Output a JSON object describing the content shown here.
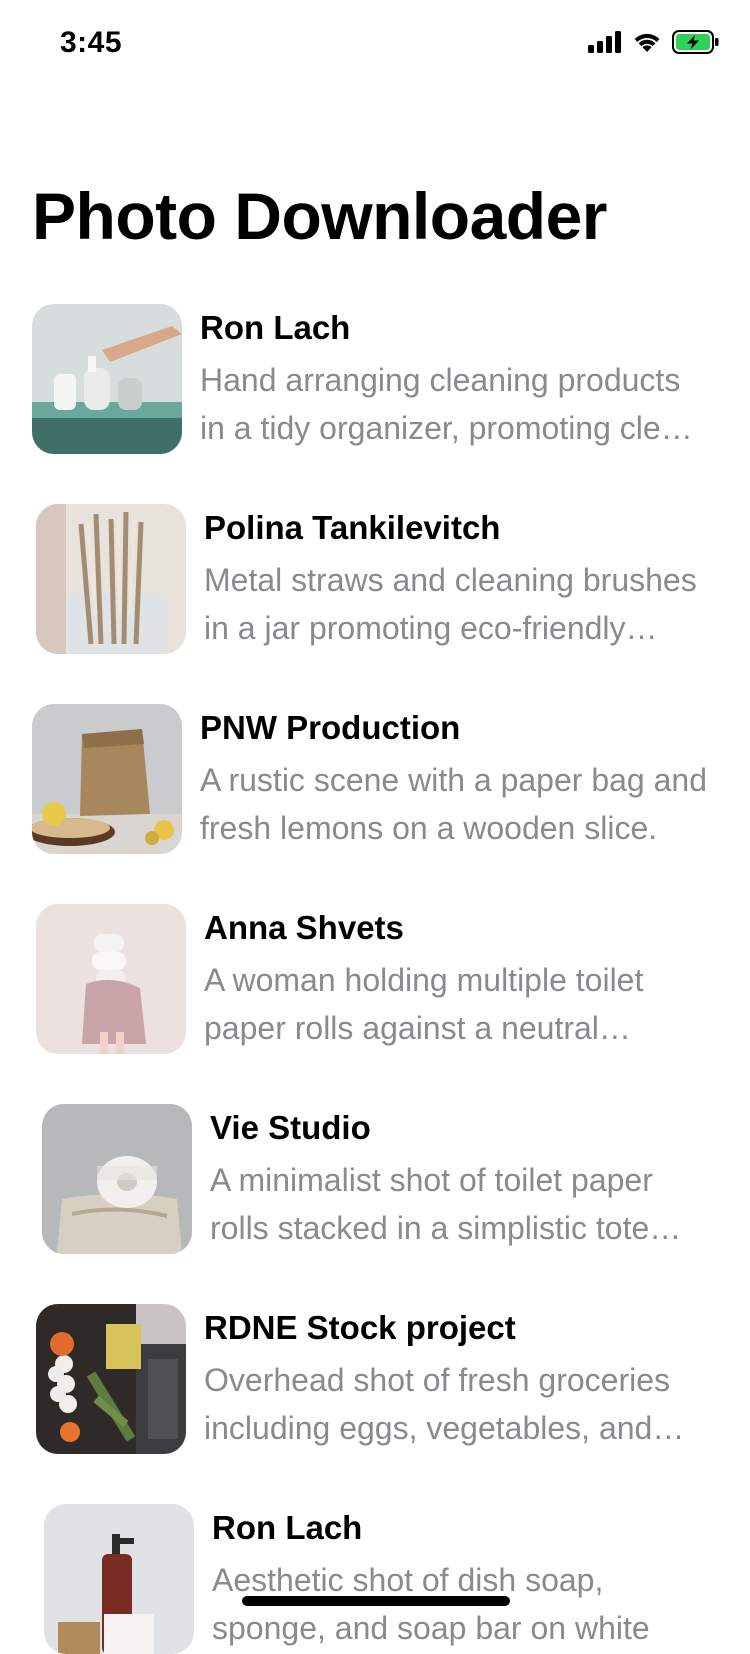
{
  "status_bar": {
    "time": "3:45",
    "icons": [
      "cellular-signal-icon",
      "wifi-icon",
      "battery-charging-icon"
    ],
    "battery_color": "#30d158"
  },
  "title": "Photo Downloader",
  "photos": [
    {
      "author": "Ron Lach",
      "description": "Hand arranging cleaning products in a tidy organizer, promoting clean living."
    },
    {
      "author": "Polina Tankilevitch",
      "description": "Metal straws and cleaning brushes in a jar promoting eco-friendly living."
    },
    {
      "author": "PNW Production",
      "description": "A rustic scene with a paper bag and fresh lemons on a wooden slice."
    },
    {
      "author": "Anna Shvets",
      "description": "A woman holding multiple toilet paper rolls against a neutral background."
    },
    {
      "author": "Vie Studio",
      "description": "A minimalist shot of toilet paper rolls stacked in a simplistic tote bag."
    },
    {
      "author": "RDNE Stock project",
      "description": "Overhead shot of fresh groceries including eggs, vegetables, and cleaning supplies."
    },
    {
      "author": "Ron Lach",
      "description": "Aesthetic shot of dish soap, sponge, and soap bar on white"
    }
  ]
}
